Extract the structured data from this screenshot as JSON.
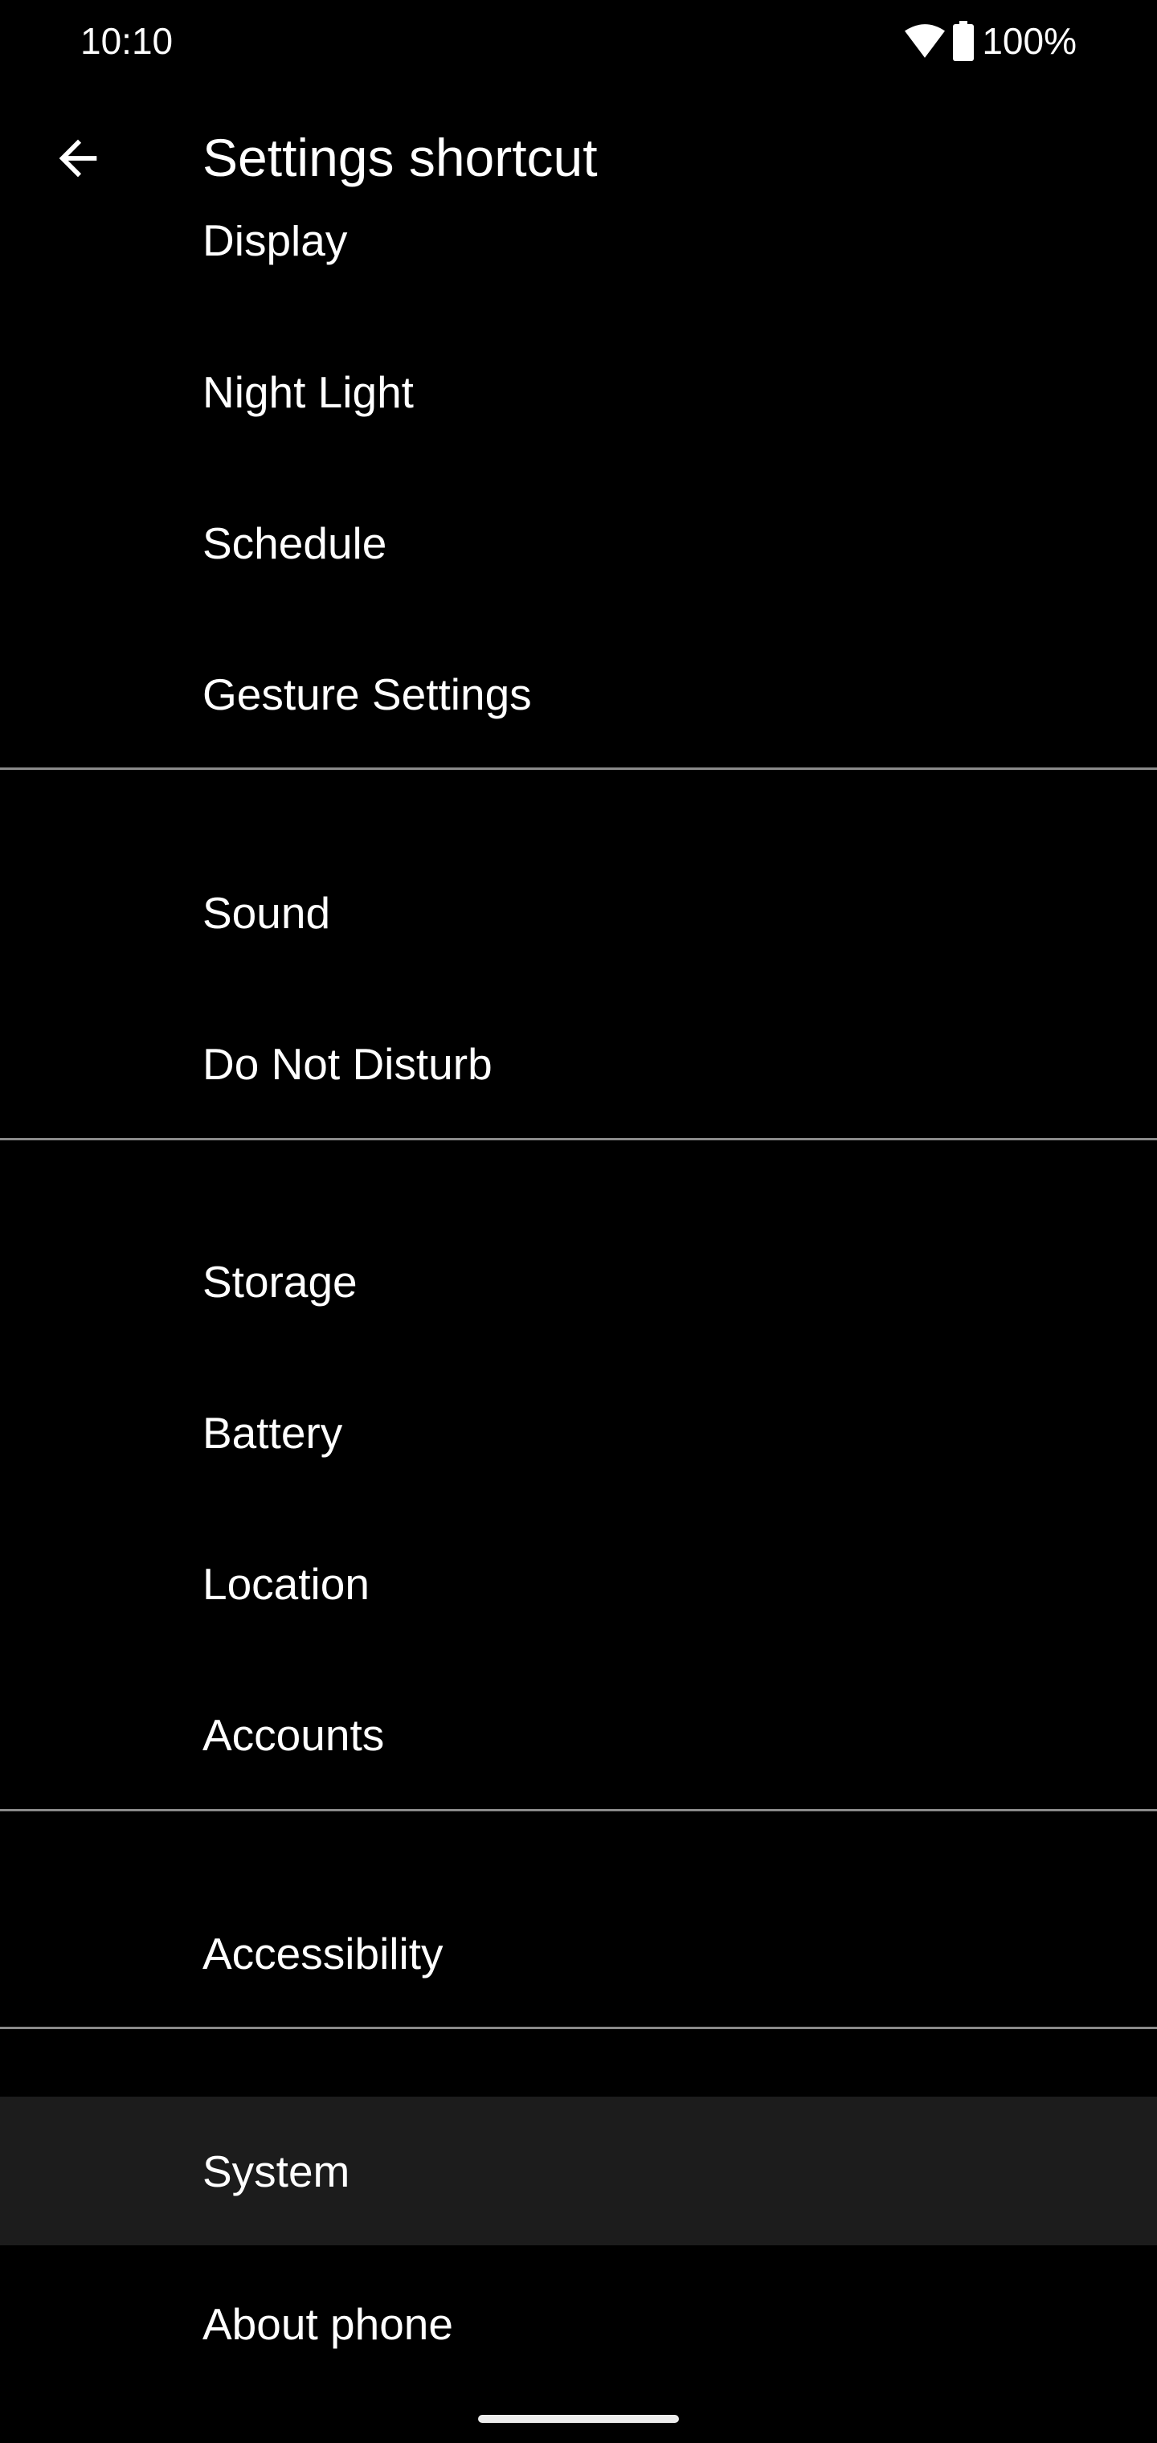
{
  "status_bar": {
    "time": "10:10",
    "battery": "100%",
    "icons": [
      "wifi-icon",
      "battery-icon"
    ]
  },
  "app_bar": {
    "title": "Settings shortcut",
    "back_icon": "arrow-back-icon"
  },
  "items": [
    {
      "label": "Display"
    },
    {
      "label": "Night Light"
    },
    {
      "label": "Schedule"
    },
    {
      "label": "Gesture Settings"
    },
    {
      "label": "Sound"
    },
    {
      "label": "Do Not Disturb"
    },
    {
      "label": "Storage"
    },
    {
      "label": "Battery"
    },
    {
      "label": "Location"
    },
    {
      "label": "Accounts"
    },
    {
      "label": "Accessibility"
    },
    {
      "label": "System",
      "selected": true
    },
    {
      "label": "About phone"
    }
  ],
  "colors": {
    "background": "#000000",
    "selected_row": "#1c1c1c",
    "divider": "#8a8a8a",
    "text": "#ffffff"
  }
}
